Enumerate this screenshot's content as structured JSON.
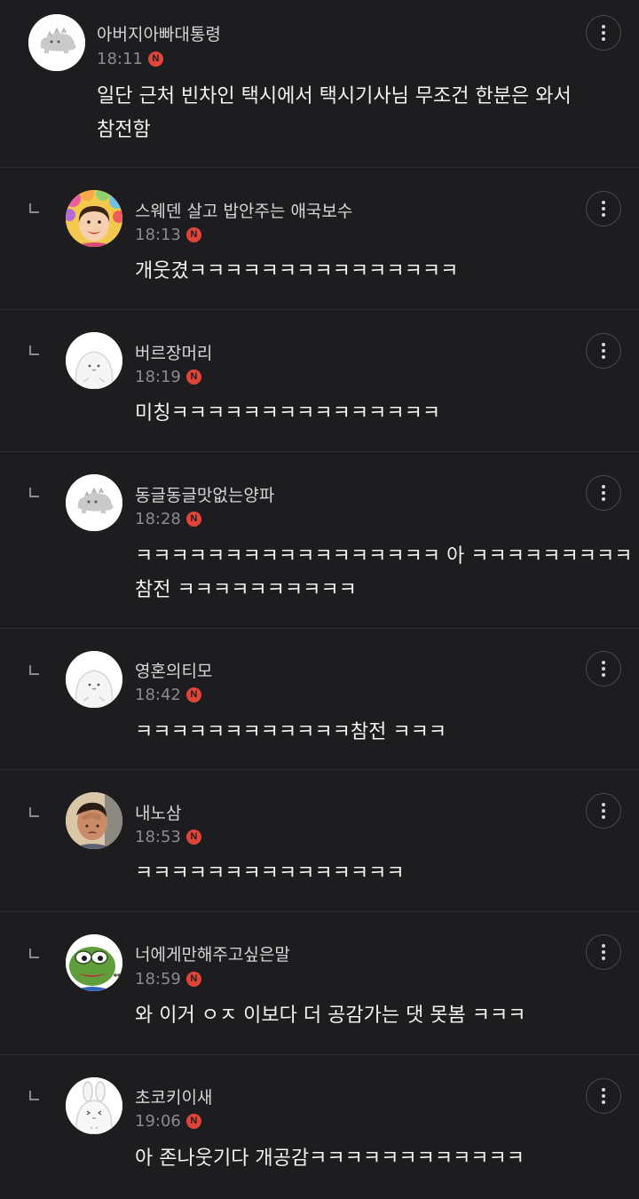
{
  "comments": [
    {
      "nickname": "아버지아빠대통령",
      "time": "18:11",
      "badge": "N",
      "text": "일단 근처 빈차인 택시에서 택시기사님 무조건 한분은 와서\n참전함",
      "avatar": "dino-avatar-icon",
      "is_reply": false
    },
    {
      "nickname": "스웨덴 살고 밥안주는 애국보수",
      "time": "18:13",
      "badge": "N",
      "text": "개웃겼ㅋㅋㅋㅋㅋㅋㅋㅋㅋㅋㅋㅋㅋㅋㅋ",
      "avatar": "flower-crown-woman-avatar",
      "is_reply": true
    },
    {
      "nickname": "버르장머리",
      "time": "18:19",
      "badge": "N",
      "text": "미칭ㅋㅋㅋㅋㅋㅋㅋㅋㅋㅋㅋㅋㅋㅋㅋ",
      "avatar": "blob-avatar-icon",
      "is_reply": true
    },
    {
      "nickname": "동글동글맛없는양파",
      "time": "18:28",
      "badge": "N",
      "text": "ㅋㅋㅋㅋㅋㅋㅋㅋㅋㅋㅋㅋㅋㅋㅋㅋㅋ 아 ㅋㅋㅋㅋㅋㅋㅋㅋㅋ\n참전 ㅋㅋㅋㅋㅋㅋㅋㅋㅋㅋ",
      "avatar": "dino-avatar-icon",
      "is_reply": true
    },
    {
      "nickname": "영혼의티모",
      "time": "18:42",
      "badge": "N",
      "text": "ㅋㅋㅋㅋㅋㅋㅋㅋㅋㅋㅋㅋ참전 ㅋㅋㅋ",
      "avatar": "blob-avatar-icon",
      "is_reply": true
    },
    {
      "nickname": "내노삼",
      "time": "18:53",
      "badge": "N",
      "text": "ㅋㅋㅋㅋㅋㅋㅋㅋㅋㅋㅋㅋㅋㅋㅋ",
      "avatar": "man-head-in-hand-avatar",
      "is_reply": true
    },
    {
      "nickname": "너에게만해주고싶은말",
      "time": "18:59",
      "badge": "N",
      "text": "와 이거 ㅇㅈ 이보다 더 공감가는 댓 못봄 ㅋㅋㅋ",
      "avatar": "pepe-frog-avatar",
      "is_reply": true
    },
    {
      "nickname": "초코키이새",
      "time": "19:06",
      "badge": "N",
      "text": "아 존나웃기다 개공감ㅋㅋㅋㅋㅋㅋㅋㅋㅋㅋㅋㅋ",
      "avatar": "bunny-avatar-icon",
      "is_reply": true
    }
  ],
  "colors": {
    "background": "#1d1d1f",
    "divider": "#2c2c2e",
    "badge": "#e0453a",
    "nickname": "#d6d6d8",
    "time": "#8c8c90",
    "text": "#f2f2f2"
  },
  "more_icon": "more-vertical-icon",
  "reply_icon": "reply-corner-icon"
}
